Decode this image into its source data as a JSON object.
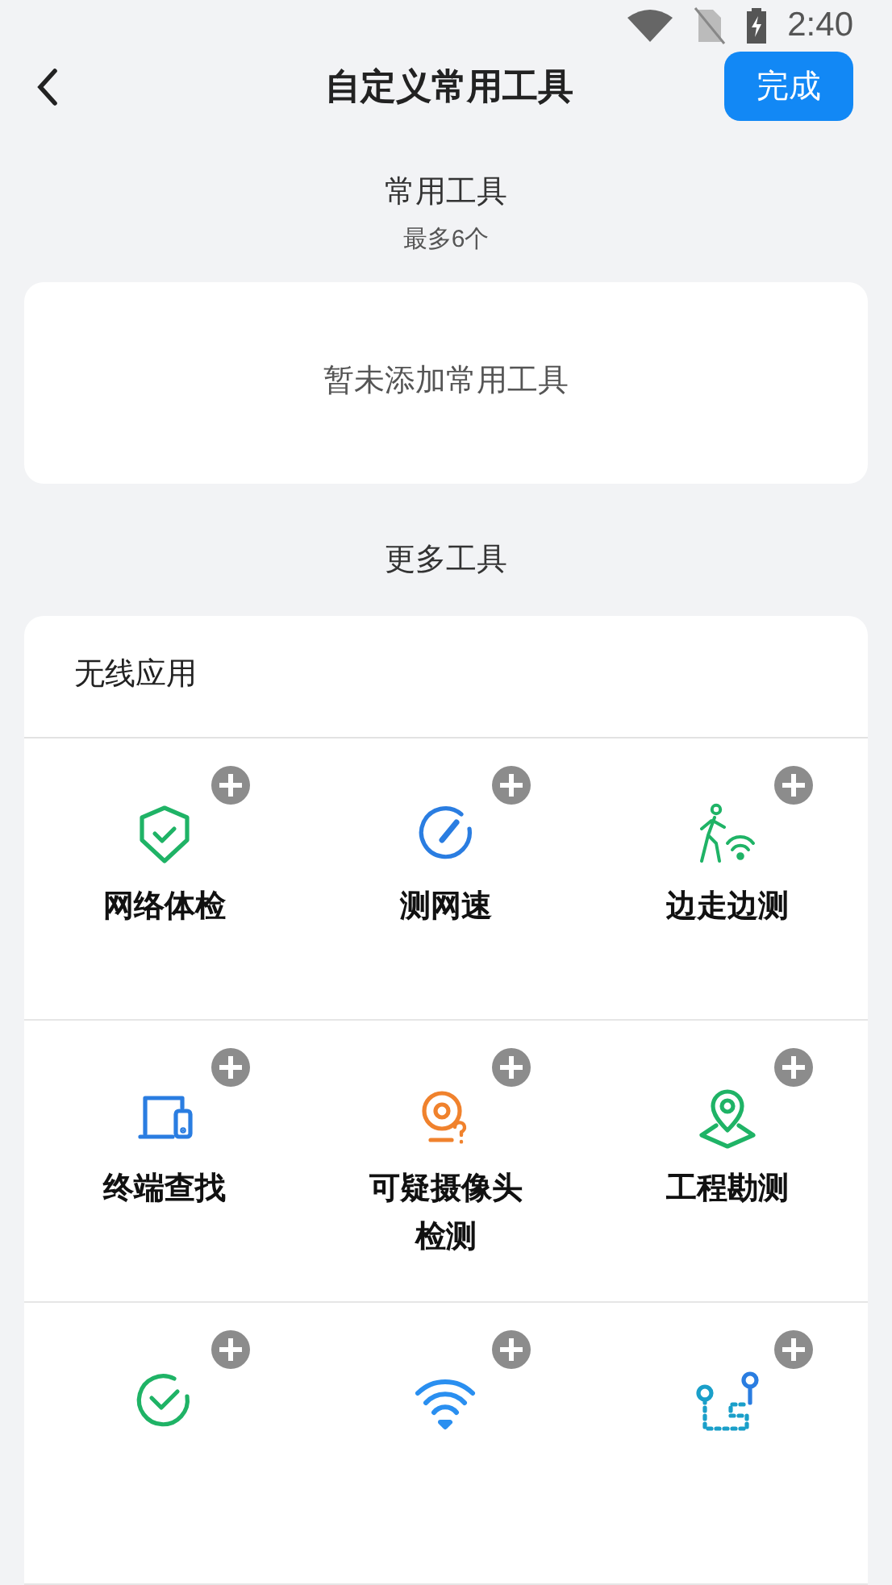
{
  "status_bar": {
    "time": "2:40"
  },
  "header": {
    "title": "自定义常用工具",
    "done_button": "完成"
  },
  "favorites": {
    "title": "常用工具",
    "subtitle": "最多6个",
    "empty_text": "暂未添加常用工具"
  },
  "more": {
    "title": "更多工具",
    "category": "无线应用",
    "tools": [
      {
        "kind": "shield",
        "label": "网络体检"
      },
      {
        "kind": "speed",
        "label": "测网速"
      },
      {
        "kind": "walk",
        "label": "边走边测"
      },
      {
        "kind": "devices",
        "label": "终端查找"
      },
      {
        "kind": "camera",
        "label": "可疑摄像头检测"
      },
      {
        "kind": "map",
        "label": "工程勘测"
      },
      {
        "kind": "check"
      },
      {
        "kind": "wifi"
      },
      {
        "kind": "route"
      }
    ]
  }
}
